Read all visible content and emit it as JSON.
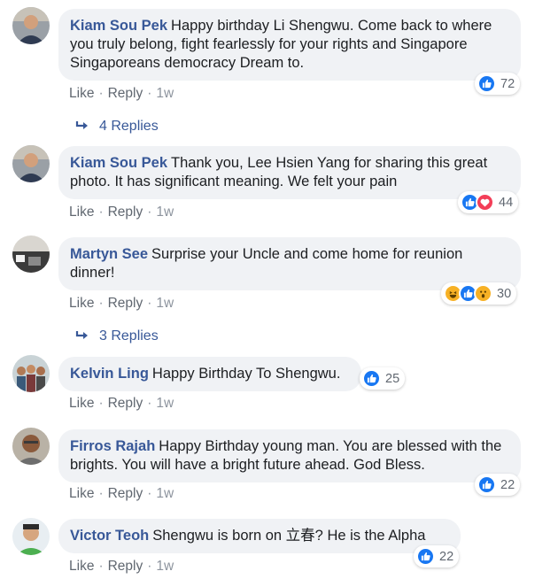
{
  "comments": [
    {
      "author": "Kiam Sou Pek",
      "text": "Happy birthday Li Shengwu. Come back to where you truly belong, fight fearlessly for your rights and Singapore Singaporeans democracy Dream to.",
      "reaction_count": "72",
      "reactions": [
        "like"
      ],
      "time": "1w"
    },
    {
      "author": "Kiam Sou Pek",
      "text": "Thank you, Lee Hsien Yang for sharing this great photo. It has significant meaning. We felt your pain",
      "reaction_count": "44",
      "reactions": [
        "like",
        "love"
      ],
      "time": "1w"
    },
    {
      "author": "Martyn See",
      "text": "Surprise your Uncle and come home for reunion dinner!",
      "reaction_count": "30",
      "reactions": [
        "haha",
        "like",
        "wow"
      ],
      "time": "1w"
    },
    {
      "author": "Kelvin Ling",
      "text": "Happy Birthday To Shengwu.",
      "reaction_count": "25",
      "reactions": [
        "like"
      ],
      "time": "1w"
    },
    {
      "author": "Firros Rajah",
      "text": "Happy Birthday young man. You are blessed with the brights. You will have a bright future ahead. God Bless.",
      "reaction_count": "22",
      "reactions": [
        "like"
      ],
      "time": "1w"
    },
    {
      "author": "Victor Teoh",
      "text": "Shengwu is born on 立春? He is the Alpha",
      "reaction_count": "22",
      "reactions": [
        "like"
      ],
      "time": "1w"
    }
  ],
  "labels": {
    "like": "Like",
    "reply": "Reply",
    "dot": "·"
  },
  "replies": [
    {
      "label": "4 Replies"
    },
    {
      "label": "3 Replies"
    }
  ],
  "colors": {
    "author": "#385898",
    "bubble": "#f0f2f5",
    "meta": "#606770",
    "like": "#1877f2",
    "love": "#f33e58",
    "haha": "#f7b125"
  }
}
